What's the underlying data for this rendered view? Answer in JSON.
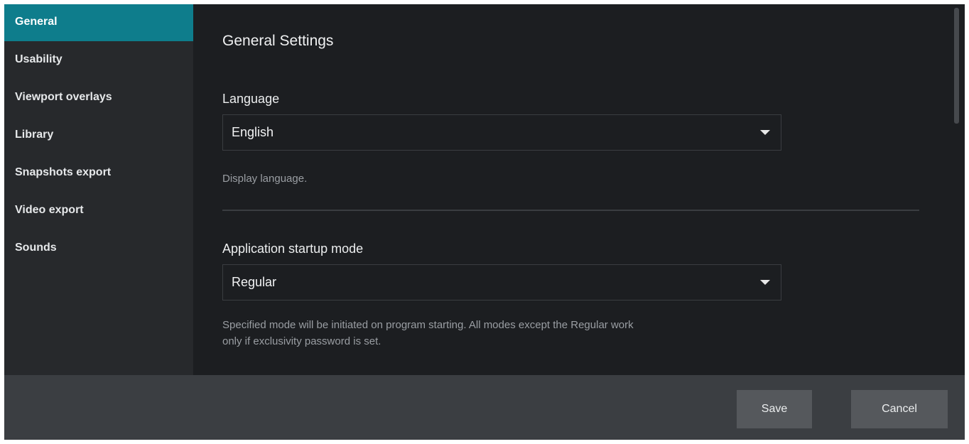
{
  "sidebar": {
    "items": [
      {
        "label": "General",
        "active": true
      },
      {
        "label": "Usability"
      },
      {
        "label": "Viewport overlays"
      },
      {
        "label": "Library"
      },
      {
        "label": "Snapshots export"
      },
      {
        "label": "Video export"
      },
      {
        "label": "Sounds"
      }
    ]
  },
  "main": {
    "title": "General Settings",
    "language": {
      "label": "Language",
      "value": "English",
      "help": "Display language."
    },
    "startup": {
      "label": "Application startup mode",
      "value": "Regular",
      "help_line1": "Specified mode will be initiated on program starting. All modes except the Regular work",
      "help_line2": "only if exclusivity password is set."
    }
  },
  "footer": {
    "save_label": "Save",
    "cancel_label": "Cancel"
  },
  "colors": {
    "accent": "#0e7d8c",
    "background": "#1c1e21",
    "sidebar": "#27292c",
    "footer": "#3b3e42"
  },
  "icons": {
    "dropdown": "caret-down-icon"
  }
}
